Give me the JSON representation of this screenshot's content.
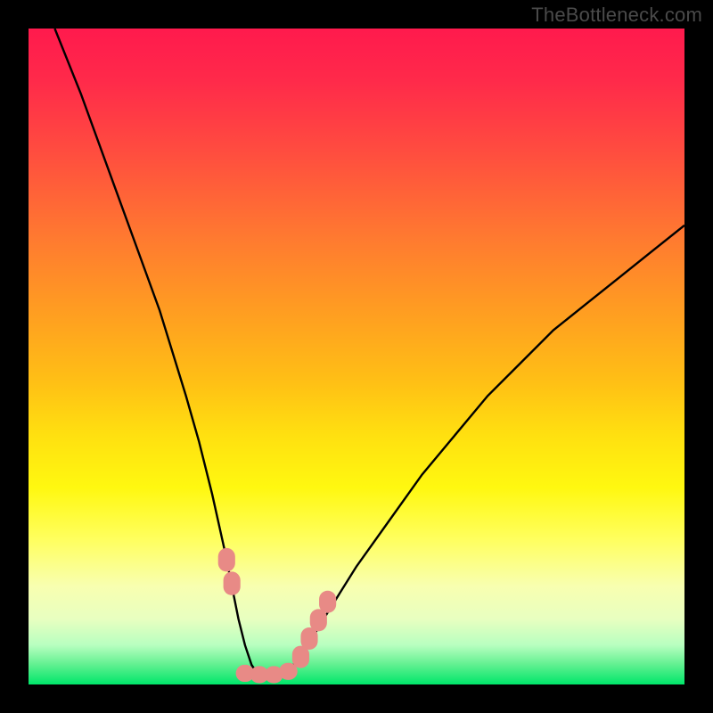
{
  "watermark": "TheBottleneck.com",
  "chart_data": {
    "type": "line",
    "title": "",
    "xlabel": "",
    "ylabel": "",
    "xlim": [
      0,
      100
    ],
    "ylim": [
      0,
      100
    ],
    "grid": false,
    "series": [
      {
        "name": "bottleneck-curve",
        "stroke": "#000000",
        "x": [
          4,
          8,
          12,
          16,
          20,
          24,
          26,
          28,
          30,
          31,
          32,
          33,
          34,
          35,
          36,
          37,
          38,
          39,
          40,
          42,
          45,
          50,
          55,
          60,
          65,
          70,
          75,
          80,
          85,
          90,
          95,
          100
        ],
        "values": [
          100,
          90,
          79,
          68,
          57,
          44,
          37,
          29,
          20,
          15,
          10,
          6,
          3,
          1.5,
          1,
          1,
          1,
          1.5,
          2.5,
          5,
          10,
          18,
          25,
          32,
          38,
          44,
          49,
          54,
          58,
          62,
          66,
          70
        ]
      }
    ],
    "annotations": [
      {
        "name": "left-marker-1",
        "shape": "round-rect",
        "fill": "#e88a86",
        "cx": 30.2,
        "cy": 19.0,
        "w": 2.6,
        "h": 3.6
      },
      {
        "name": "left-marker-2",
        "shape": "round-rect",
        "fill": "#e88a86",
        "cx": 31.0,
        "cy": 15.4,
        "w": 2.6,
        "h": 3.6
      },
      {
        "name": "floor-marker-1",
        "shape": "round-rect",
        "fill": "#e88a86",
        "cx": 33.0,
        "cy": 1.7,
        "w": 2.8,
        "h": 2.6
      },
      {
        "name": "floor-marker-2",
        "shape": "round-rect",
        "fill": "#e88a86",
        "cx": 35.2,
        "cy": 1.5,
        "w": 2.8,
        "h": 2.6
      },
      {
        "name": "floor-marker-3",
        "shape": "round-rect",
        "fill": "#e88a86",
        "cx": 37.4,
        "cy": 1.5,
        "w": 2.8,
        "h": 2.6
      },
      {
        "name": "floor-marker-4",
        "shape": "round-rect",
        "fill": "#e88a86",
        "cx": 39.6,
        "cy": 2.0,
        "w": 2.8,
        "h": 2.6
      },
      {
        "name": "right-marker-1",
        "shape": "round-rect",
        "fill": "#e88a86",
        "cx": 41.5,
        "cy": 4.2,
        "w": 2.6,
        "h": 3.4
      },
      {
        "name": "right-marker-2",
        "shape": "round-rect",
        "fill": "#e88a86",
        "cx": 42.8,
        "cy": 7.0,
        "w": 2.6,
        "h": 3.4
      },
      {
        "name": "right-marker-3",
        "shape": "round-rect",
        "fill": "#e88a86",
        "cx": 44.2,
        "cy": 9.8,
        "w": 2.6,
        "h": 3.4
      },
      {
        "name": "right-marker-4",
        "shape": "round-rect",
        "fill": "#e88a86",
        "cx": 45.6,
        "cy": 12.6,
        "w": 2.6,
        "h": 3.4
      }
    ],
    "gradient_bands": [
      {
        "name": "red-top",
        "approx_y_pct_from_top": 0,
        "color": "#ff1a4d"
      },
      {
        "name": "orange-mid",
        "approx_y_pct_from_top": 40,
        "color": "#ffa020"
      },
      {
        "name": "yellow-lower",
        "approx_y_pct_from_top": 70,
        "color": "#fff810"
      },
      {
        "name": "green-bottom",
        "approx_y_pct_from_top": 100,
        "color": "#00e66a"
      }
    ]
  }
}
